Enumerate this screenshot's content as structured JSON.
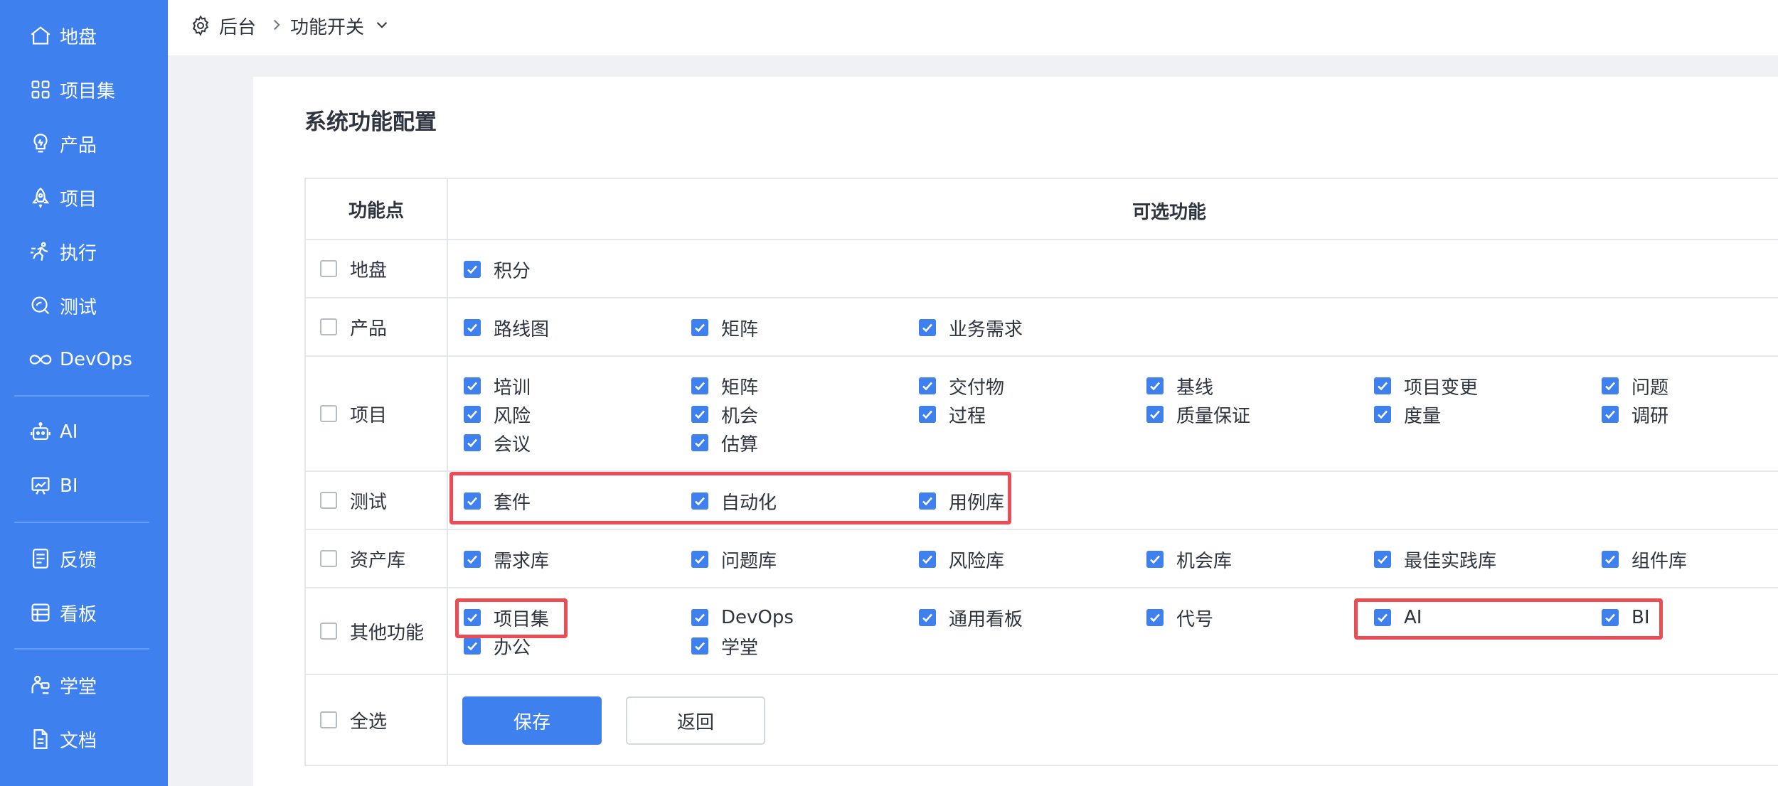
{
  "sidebar": {
    "items": [
      {
        "label": "地盘",
        "icon": "home-icon"
      },
      {
        "label": "项目集",
        "icon": "grid-icon"
      },
      {
        "label": "产品",
        "icon": "lightbulb-icon"
      },
      {
        "label": "项目",
        "icon": "rocket-icon"
      },
      {
        "label": "执行",
        "icon": "run-icon"
      },
      {
        "label": "测试",
        "icon": "search-bug-icon"
      },
      {
        "label": "DevOps",
        "icon": "infinity-icon"
      },
      {
        "label": "AI",
        "icon": "robot-icon"
      },
      {
        "label": "BI",
        "icon": "presentation-icon"
      },
      {
        "label": "反馈",
        "icon": "feedback-icon"
      },
      {
        "label": "看板",
        "icon": "kanban-icon"
      },
      {
        "label": "学堂",
        "icon": "school-icon"
      },
      {
        "label": "文档",
        "icon": "document-icon"
      }
    ]
  },
  "breadcrumb": {
    "root": "后台",
    "current": "功能开关"
  },
  "page": {
    "title": "系统功能配置"
  },
  "table": {
    "headers": {
      "left": "功能点",
      "right": "可选功能"
    },
    "rows": [
      {
        "label": "地盘",
        "options": [
          "积分"
        ]
      },
      {
        "label": "产品",
        "options": [
          "路线图",
          "矩阵",
          "业务需求"
        ]
      },
      {
        "label": "项目",
        "options": [
          "培训",
          "矩阵",
          "交付物",
          "基线",
          "项目变更",
          "问题",
          "风险",
          "机会",
          "过程",
          "质量保证",
          "度量",
          "调研",
          "会议",
          "估算"
        ]
      },
      {
        "label": "测试",
        "options": [
          "套件",
          "自动化",
          "用例库"
        ]
      },
      {
        "label": "资产库",
        "options": [
          "需求库",
          "问题库",
          "风险库",
          "机会库",
          "最佳实践库",
          "组件库"
        ]
      },
      {
        "label": "其他功能",
        "options": [
          "项目集",
          "DevOps",
          "通用看板",
          "代号",
          "AI",
          "BI",
          "办公",
          "学堂"
        ]
      }
    ],
    "select_all_label": "全选"
  },
  "buttons": {
    "save": "保存",
    "back": "返回"
  },
  "colors": {
    "accent": "#3d80ee",
    "highlight": "#ec4d55",
    "sidebar_bg": "#3d80ee"
  }
}
